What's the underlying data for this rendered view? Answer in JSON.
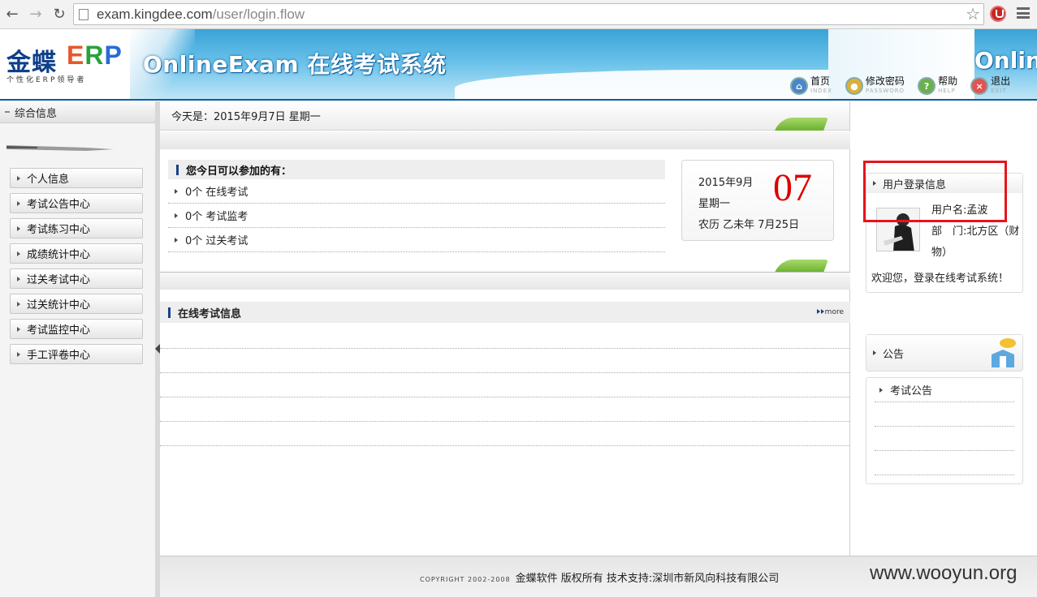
{
  "browser": {
    "url_host": "exam.kingdee.com",
    "url_path": "/user/login.flow"
  },
  "header": {
    "logo_cn": "金蝶",
    "logo_erp_e": "E",
    "logo_erp_r": "R",
    "logo_erp_p": "P",
    "logo_sub": "个性化ERP领导者",
    "title": "OnlineExam 在线考试系统",
    "title_repeat": "Online",
    "links": [
      {
        "cn": "首页",
        "en": "INDEX"
      },
      {
        "cn": "修改密码",
        "en": "PASSWORD"
      },
      {
        "cn": "帮助",
        "en": "HELP"
      },
      {
        "cn": "退出",
        "en": "EXIT"
      }
    ]
  },
  "sidebar": {
    "title": "综合信息",
    "items": [
      {
        "label": "个人信息"
      },
      {
        "label": "考试公告中心"
      },
      {
        "label": "考试练习中心"
      },
      {
        "label": "成绩统计中心"
      },
      {
        "label": "过关考试中心"
      },
      {
        "label": "过关统计中心"
      },
      {
        "label": "考试监控中心"
      },
      {
        "label": "手工评卷中心"
      }
    ]
  },
  "main": {
    "today": "今天是：2015年9月7日 星期一",
    "exam_panel_title": "您今日可以参加的有：",
    "exam_rows": [
      {
        "label": "0个 在线考试"
      },
      {
        "label": "0个 考试监考"
      },
      {
        "label": "0个 过关考试"
      }
    ],
    "calendar": {
      "year_month": "2015年9月",
      "weekday": "星期一",
      "lunar": "农历 乙未年 7月25日",
      "day": "07"
    },
    "info_title": "在线考试信息",
    "more_label": "more"
  },
  "right": {
    "login_title": "用户登录信息",
    "username_line": "用户名:孟波",
    "dept_line1": "部　门:北方区（财",
    "dept_line2": "物）",
    "welcome": "欢迎您，登录在线考试系统！",
    "notice_title": "公告",
    "notice_items": [
      {
        "label": "考试公告"
      }
    ]
  },
  "footer": {
    "copyright": "COPYRIGHT 2002-2008",
    "text": "金蝶软件 版权所有 技术支持:深圳市新风向科技有限公司"
  },
  "watermark": "www.wooyun.org",
  "colors": {
    "accent_blue": "#1b3f8a",
    "banner_blue": "#3aa3d8",
    "highlight_red": "#e8131b",
    "day_red": "#dd0000"
  }
}
